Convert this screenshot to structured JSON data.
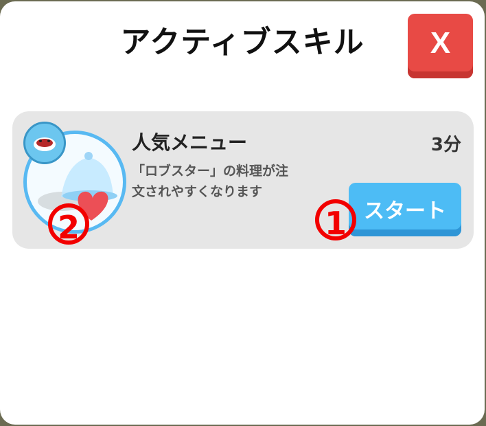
{
  "dialog": {
    "title": "アクティブスキル",
    "close_label": "X"
  },
  "skill": {
    "name": "人気メニュー",
    "description": "「ロブスター」の料理が注文されやすくなります",
    "duration": "3分",
    "start_label": "スタート"
  },
  "annotations": {
    "marker_1": "1",
    "marker_2": "2"
  },
  "colors": {
    "close": "#e84a45",
    "start": "#4dbcf5",
    "card": "#e6e6e6",
    "marker": "#f20000"
  }
}
